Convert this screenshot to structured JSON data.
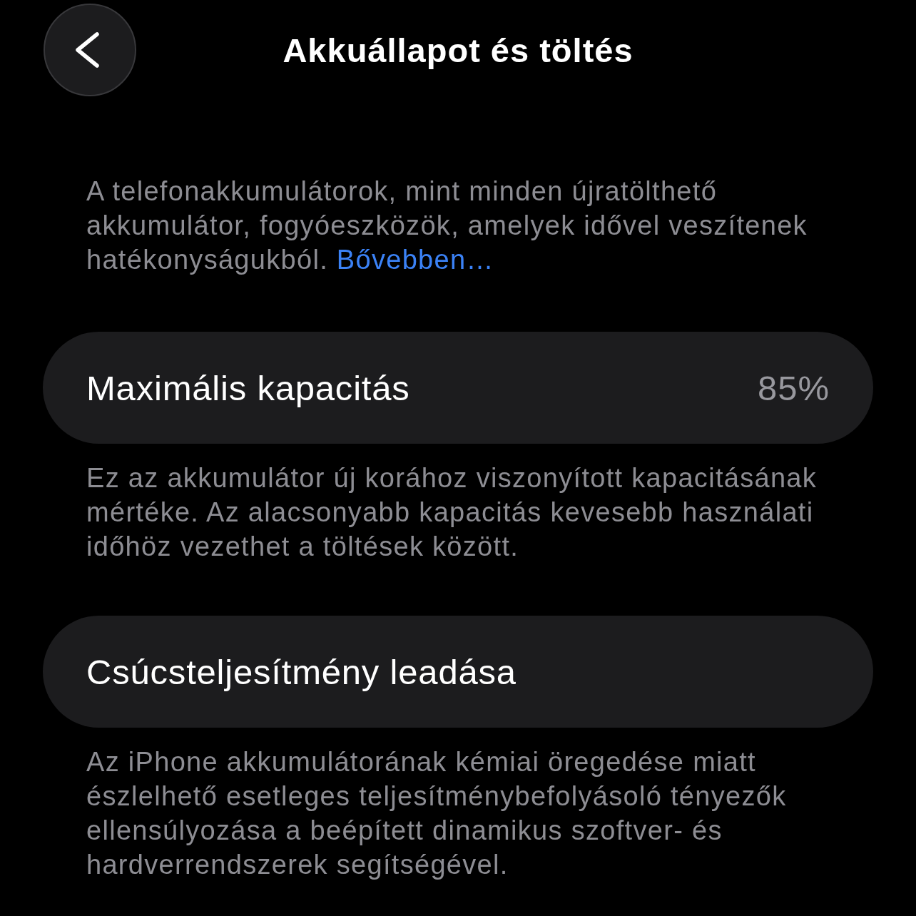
{
  "nav": {
    "title": "Akkuállapot és töltés"
  },
  "intro": {
    "text": "A telefonakkumulátorok, mint minden újratölthető akkumulátor, fogyóeszközök, amelyek idővel veszítenek hatékonyságukból.",
    "link": "Bővebben…"
  },
  "sections": [
    {
      "label": "Maximális kapacitás",
      "value": "85%",
      "footer": "Ez az akkumulátor új korához viszonyított kapacitásának mértéke. Az alacsonyabb kapacitás kevesebb használati időhöz vezethet a töltések között."
    },
    {
      "label": "Csúcsteljesítmény leadása",
      "footer": "Az iPhone akkumulátorának kémiai öregedése miatt észlelhető esetleges teljesítménybefolyásoló tényezők ellensúlyozása a beépített dinamikus szoftver- és hardverrendszerek segítségével."
    }
  ]
}
